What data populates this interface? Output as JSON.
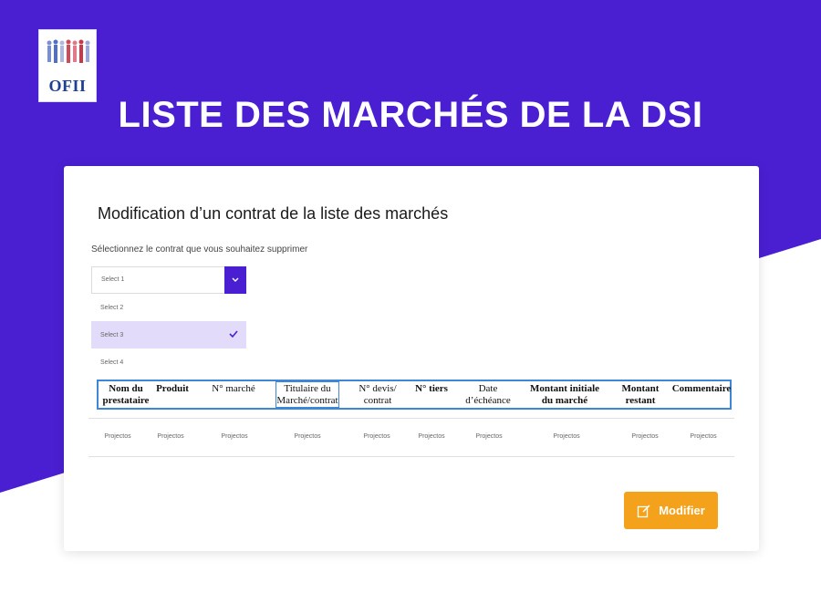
{
  "logo": {
    "text": "OFII"
  },
  "page_title": "LISTE DES MARCHÉS DE LA DSI",
  "card": {
    "title": "Modification d’un contrat de la liste des marchés",
    "instruction": "Sélectionnez le contrat que vous souhaitez supprimer"
  },
  "select": {
    "current_value": "Select 1",
    "options": [
      "Select 2",
      "Select 3",
      "Select 4"
    ],
    "selected_option": "Select 3"
  },
  "table": {
    "headers": [
      "Nom du prestataire",
      "Produit",
      "N° marché",
      "Titulaire du Marché/contrat",
      "N° devis/ contrat",
      "N° tiers",
      "Date d’échéance",
      "Montant initiale du marché",
      "Montant restant",
      "Commentaire"
    ],
    "row": [
      "Projectos",
      "Projectos",
      "Projectos",
      "Projectos",
      "Projectos",
      "Projectos",
      "Projectos",
      "Projectos",
      "Projectos",
      "Projectos"
    ]
  },
  "actions": {
    "modify_label": "Modifier"
  },
  "colors": {
    "primary": "#4a1fd1",
    "accent": "#f4a21c",
    "selected_bg": "#e2dcfa",
    "header_border": "#3d86d8"
  },
  "icons": {
    "dropdown": "chevron-down-icon",
    "check": "check-icon",
    "modify": "edit-icon"
  }
}
